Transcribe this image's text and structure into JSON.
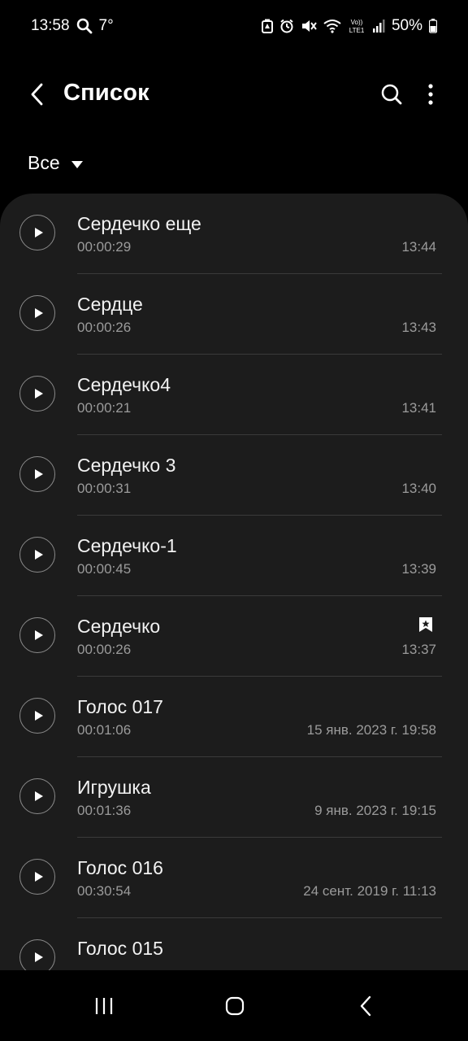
{
  "status_bar": {
    "time": "13:58",
    "temperature": "7°",
    "battery": "50%",
    "icons": [
      "search-icon",
      "battery-saver-icon",
      "alarm-icon",
      "mute-icon",
      "wifi-icon",
      "volte-icon",
      "signal-icon",
      "battery-icon"
    ]
  },
  "header": {
    "title": "Список",
    "back_icon": "back-arrow-icon",
    "search_icon": "search-icon",
    "more_icon": "more-vert-icon"
  },
  "filter": {
    "label": "Все",
    "icon": "dropdown-triangle-icon"
  },
  "recordings": [
    {
      "name": "Сердечко еще",
      "duration": "00:00:29",
      "date": "13:44",
      "bookmarked": false
    },
    {
      "name": "Сердце",
      "duration": "00:00:26",
      "date": "13:43",
      "bookmarked": false
    },
    {
      "name": "Сердечко4",
      "duration": "00:00:21",
      "date": "13:41",
      "bookmarked": false
    },
    {
      "name": "Сердечко 3",
      "duration": "00:00:31",
      "date": "13:40",
      "bookmarked": false
    },
    {
      "name": "Сердечко-1",
      "duration": "00:00:45",
      "date": "13:39",
      "bookmarked": false
    },
    {
      "name": "Сердечко",
      "duration": "00:00:26",
      "date": "13:37",
      "bookmarked": true
    },
    {
      "name": "Голос 017",
      "duration": "00:01:06",
      "date": "15 янв. 2023 г. 19:58",
      "bookmarked": false
    },
    {
      "name": "Игрушка",
      "duration": "00:01:36",
      "date": "9 янв. 2023 г. 19:15",
      "bookmarked": false
    },
    {
      "name": "Голос 016",
      "duration": "00:30:54",
      "date": "24 сент. 2019 г. 11:13",
      "bookmarked": false
    },
    {
      "name": "Голос 015",
      "duration": "",
      "date": "",
      "bookmarked": false
    }
  ],
  "nav_bar": {
    "icons": [
      "recent-apps-icon",
      "home-icon",
      "back-icon"
    ]
  },
  "colors": {
    "background": "#000000",
    "panel": "#1c1c1c",
    "secondary_text": "#9b9b9b",
    "divider": "#3a3a3a"
  }
}
